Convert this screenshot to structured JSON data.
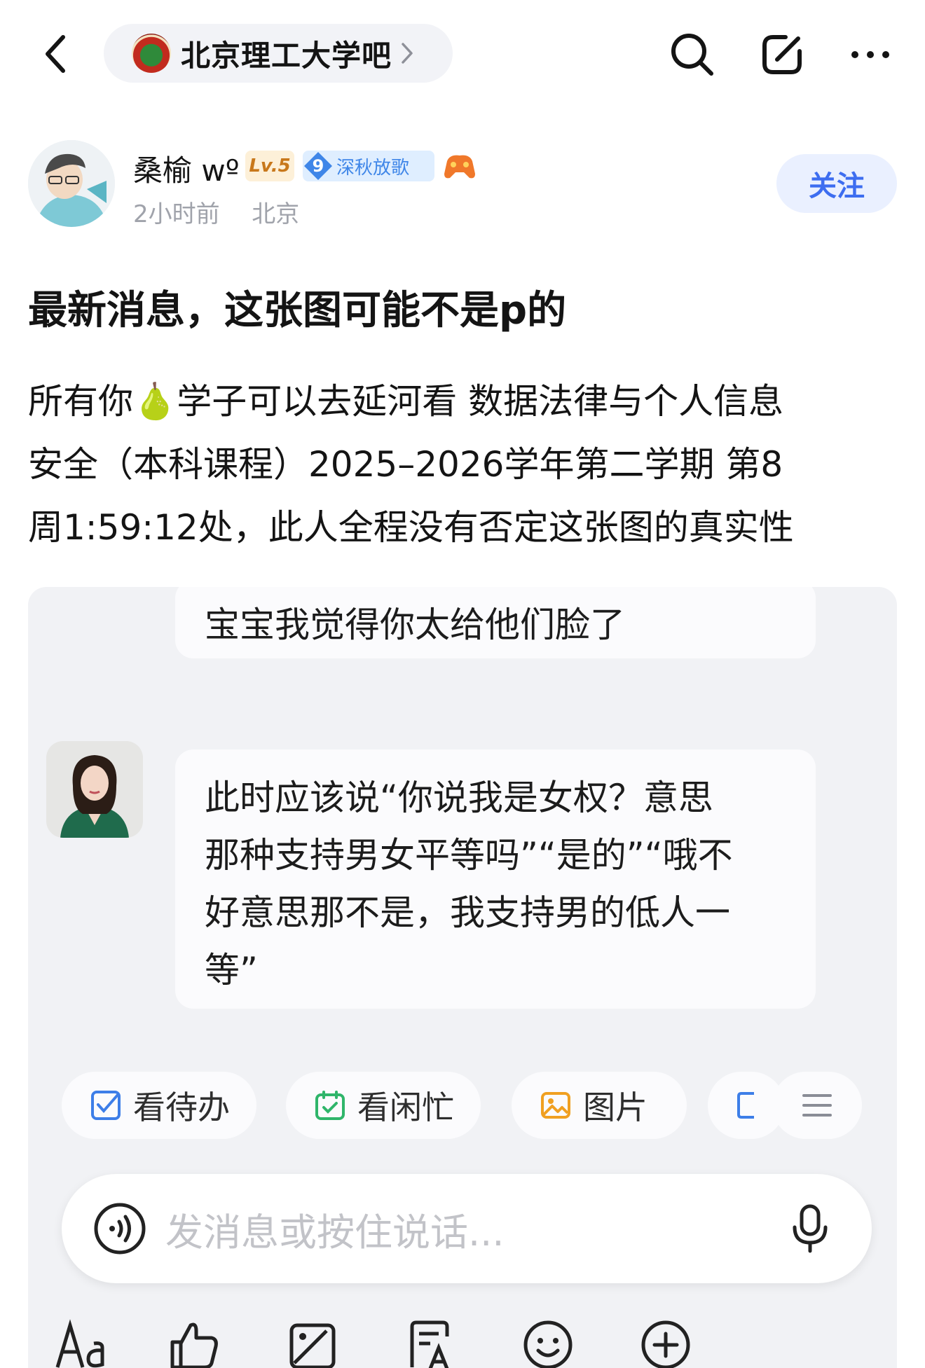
{
  "topbar": {
    "forum_name": "北京理工大学吧"
  },
  "author": {
    "name": "桑榆 wº",
    "level": "Lv.5",
    "medal_number": "9",
    "medal_text": "深秋放歌",
    "time": "2小时前",
    "location": "北京",
    "follow_label": "关注"
  },
  "post": {
    "title": "最新消息，这张图可能不是p的",
    "body_lines": [
      "所有你🍐学子可以去延河看 数据法律与个人信息",
      "安全（本科课程）2025–2026学年第二学期 第8",
      "周1:59:12处，此人全程没有否定这张图的真实性"
    ]
  },
  "screenshot": {
    "bubble_top": "宝宝我觉得你太给他们脸了",
    "bubble_main_lines": [
      "此时应该说“你说我是女权？意思",
      "那种支持男女平等吗”“是的”“哦不",
      "好意思那不是，我支持男的低人一",
      "等”"
    ],
    "chips": [
      "看待办",
      "看闲忙",
      "图片"
    ],
    "input_placeholder": "发消息或按住说话..."
  }
}
